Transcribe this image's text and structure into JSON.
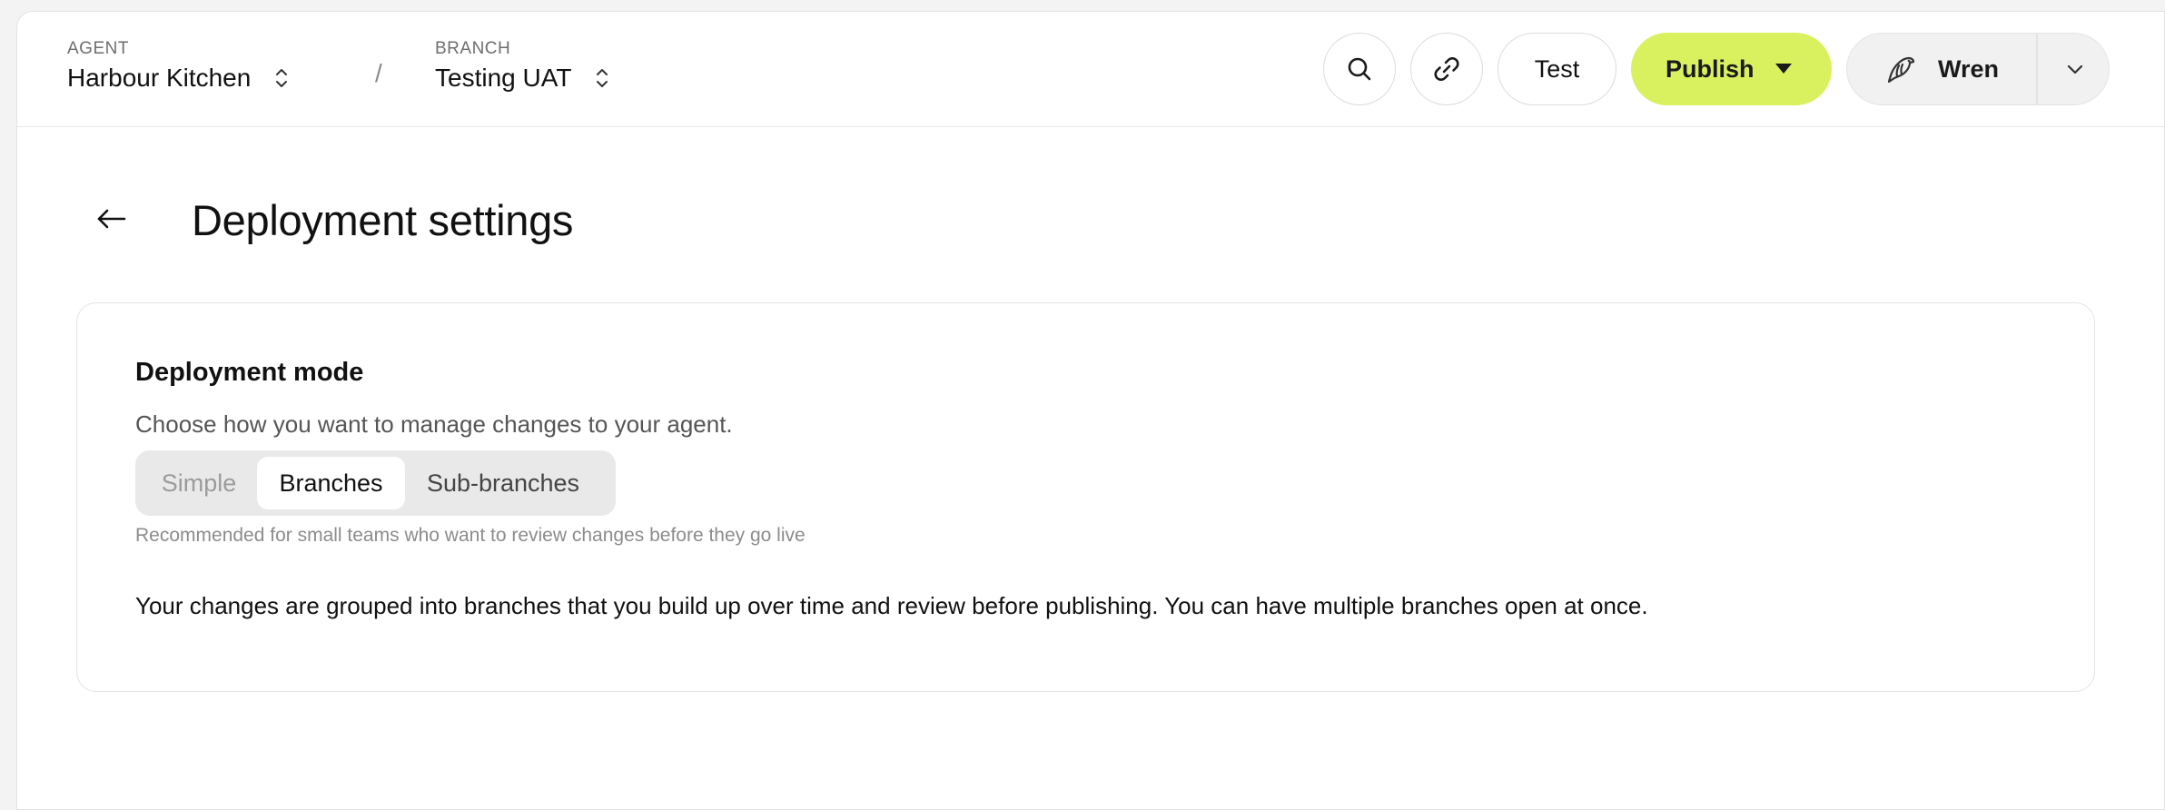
{
  "topbar": {
    "agent": {
      "caption": "AGENT",
      "value": "Harbour Kitchen"
    },
    "separator": "/",
    "branch": {
      "caption": "BRANCH",
      "value": "Testing UAT"
    },
    "test_label": "Test",
    "publish_label": "Publish",
    "user_name": "Wren",
    "accent_color": "#d9f15f"
  },
  "header": {
    "title": "Deployment settings"
  },
  "card": {
    "heading": "Deployment mode",
    "description": "Choose how you want to manage changes to your agent.",
    "segments": [
      {
        "label": "Simple",
        "state": "disabled"
      },
      {
        "label": "Branches",
        "state": "selected"
      },
      {
        "label": "Sub-branches",
        "state": "default"
      }
    ],
    "hint": "Recommended for small teams who want to review changes before they go live",
    "body": "Your changes are grouped into branches that you build up over time and review before publishing. You can have multiple branches open at once."
  },
  "icons": [
    "chevron-up-down-icon",
    "search-icon",
    "link-icon",
    "caret-down-icon",
    "bird-icon",
    "chevron-down-icon",
    "arrow-left-icon"
  ]
}
